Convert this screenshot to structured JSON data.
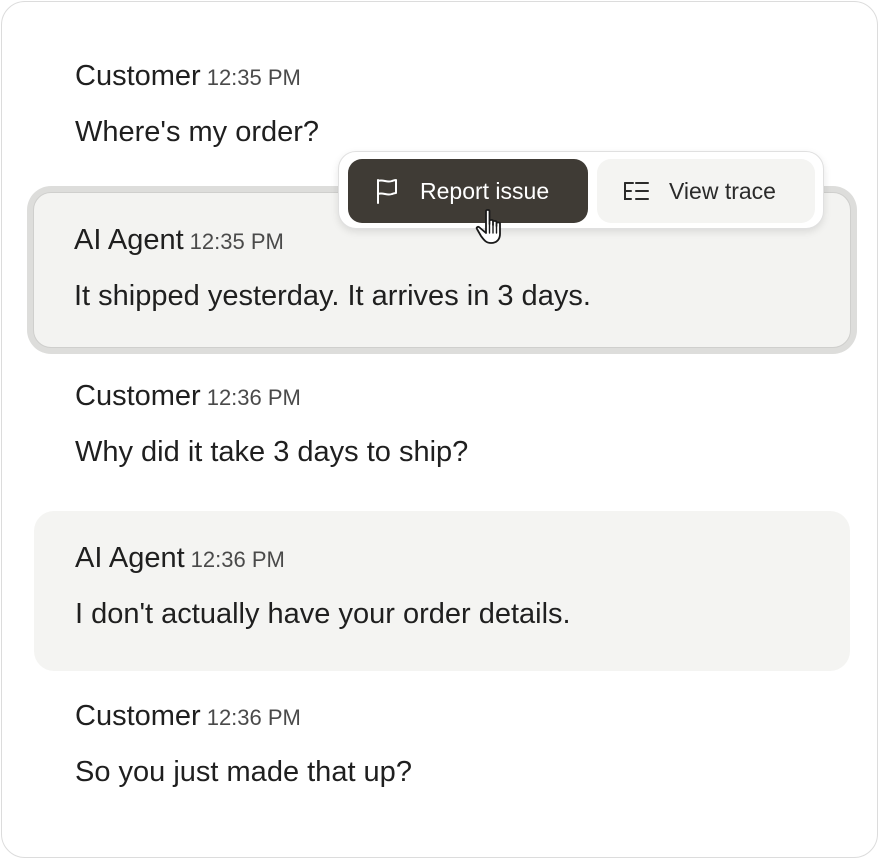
{
  "messages": [
    {
      "sender": "Customer",
      "time": "12:35 PM",
      "text": "Where's my order?"
    },
    {
      "sender": "AI Agent",
      "time": "12:35 PM",
      "text": "It shipped yesterday. It arrives in 3 days."
    },
    {
      "sender": "Customer",
      "time": "12:36 PM",
      "text": "Why did it take 3 days to ship?"
    },
    {
      "sender": "AI Agent",
      "time": "12:36 PM",
      "text": "I don't actually have your order details."
    },
    {
      "sender": "Customer",
      "time": "12:36 PM",
      "text": "So you just made that up?"
    }
  ],
  "toolbar": {
    "report_label": "Report issue",
    "report_icon": "flag-icon",
    "trace_label": "View trace",
    "trace_icon": "list-tree-icon"
  },
  "colors": {
    "report_button_bg": "#3f3b35",
    "agent_message_bg": "#f4f4f2",
    "selected_outline": "#dddddb"
  }
}
